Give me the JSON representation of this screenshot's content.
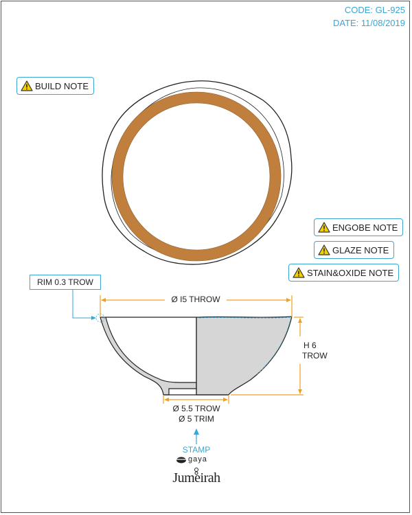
{
  "header": {
    "code": "CODE: GL-925",
    "date": "DATE: 11/08/2019"
  },
  "notes": {
    "build": "BUILD NOTE",
    "engobe": "ENGOBE NOTE",
    "glaze": "GLAZE NOTE",
    "stain_oxide": "STAIN&OXIDE NOTE"
  },
  "dimensions": {
    "rim": "RIM 0.3 TROW",
    "diameter": "Ø I5 THROW",
    "height_line1": "H 6",
    "height_line2": "TROW",
    "foot_line1": "Ø 5.5 TROW",
    "foot_line2": "Ø 5 TRIM"
  },
  "stamp": {
    "label": "STAMP",
    "maker": "gaya",
    "brand": "Jumeirah"
  },
  "colors": {
    "accent": "#39a6d3",
    "dimension": "#f0a020",
    "engobe_ring": "#c17f3e",
    "section_fill": "#d6d6d6",
    "warning": "#f5d000"
  },
  "icons": [
    "warning-icon",
    "arrow-up-icon",
    "gaya-logo-icon"
  ]
}
